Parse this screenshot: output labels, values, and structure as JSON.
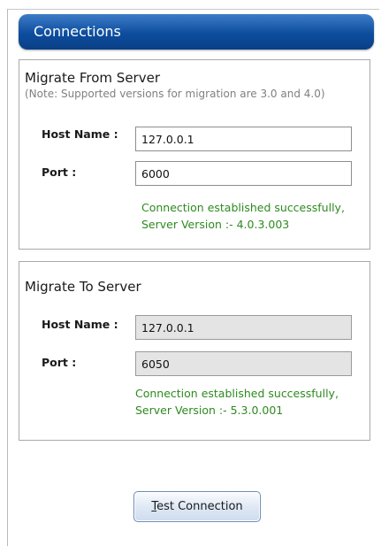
{
  "header": {
    "title": "Connections"
  },
  "migrate_from": {
    "title": "Migrate From Server",
    "note": "(Note: Supported versions for migration are 3.0 and 4.0)",
    "host_label": "Host Name :",
    "host_value": "127.0.0.1",
    "port_label": "Port :",
    "port_value": "6000",
    "status_line1": "Connection established successfully,",
    "status_line2": "Server Version :- 4.0.3.003",
    "status_color": "#2d8a1f"
  },
  "migrate_to": {
    "title": "Migrate To Server",
    "host_label": "Host Name :",
    "host_value": "127.0.0.1",
    "port_label": "Port :",
    "port_value": "6050",
    "status_line1": "Connection established successfully,",
    "status_line2": "Server Version :- 5.3.0.001",
    "status_color": "#2d8a1f"
  },
  "actions": {
    "test_connection_mnemonic": "T",
    "test_connection_rest": "est Connection"
  },
  "colors": {
    "header_blue": "#0d4d9e",
    "readonly_field": "#e4e4e4"
  }
}
